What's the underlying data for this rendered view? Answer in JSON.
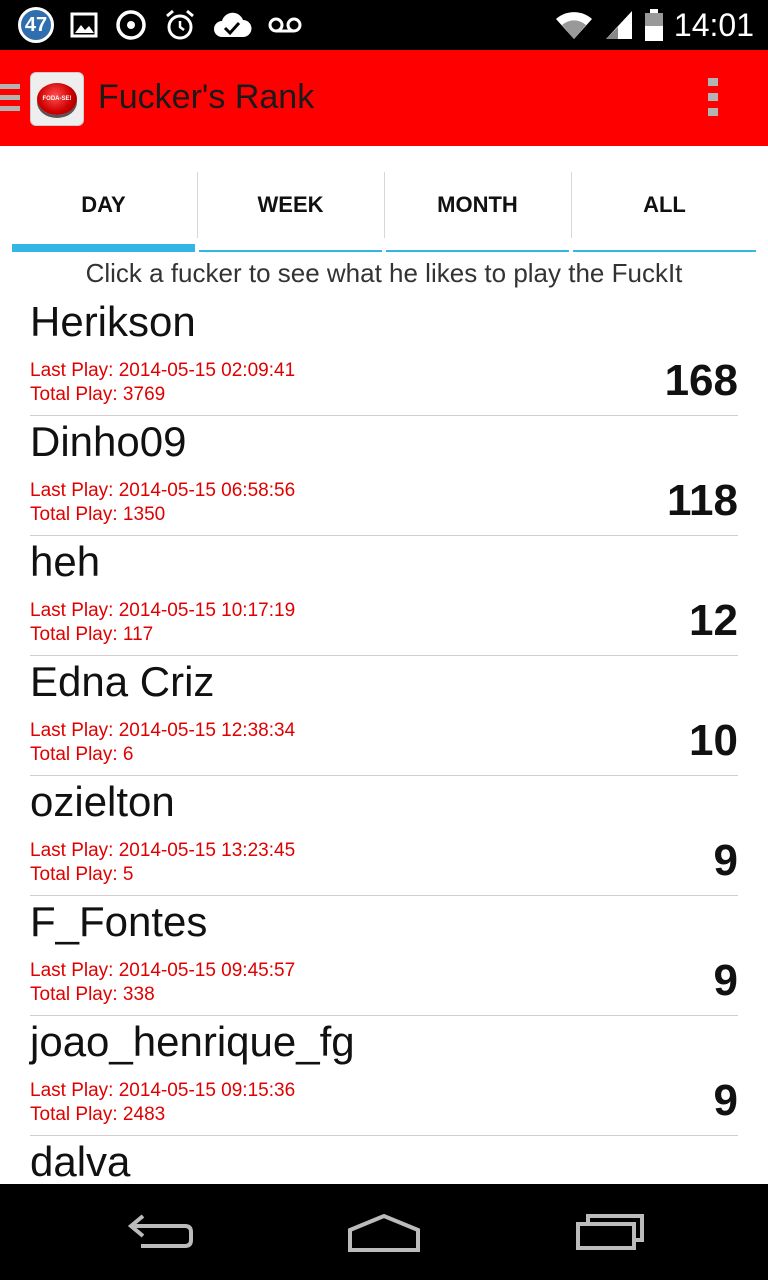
{
  "status_bar": {
    "notification_count": "47",
    "time": "14:01",
    "left_icons": [
      "notification-count-icon",
      "image-icon",
      "sync-icon",
      "alarm-icon",
      "cloud-check-icon",
      "voicemail-icon"
    ],
    "right_icons": [
      "wifi-icon",
      "signal-icon",
      "battery-icon"
    ]
  },
  "action_bar": {
    "title": "Fucker's Rank",
    "logo_text": "FODA-SE!",
    "color": "#ff0000"
  },
  "tabs": [
    {
      "label": "DAY",
      "active": true
    },
    {
      "label": "WEEK",
      "active": false
    },
    {
      "label": "MONTH",
      "active": false
    },
    {
      "label": "ALL",
      "active": false
    }
  ],
  "hint": "Click a fucker to see what he likes to play the FuckIt",
  "rank": [
    {
      "name": "Herikson",
      "last_play": "Last Play: 2014-05-15 02:09:41",
      "total_play": "Total Play: 3769",
      "score": "168"
    },
    {
      "name": "Dinho09",
      "last_play": "Last Play: 2014-05-15 06:58:56",
      "total_play": "Total Play: 1350",
      "score": "118"
    },
    {
      "name": "heh",
      "last_play": "Last Play: 2014-05-15 10:17:19",
      "total_play": "Total Play: 117",
      "score": "12"
    },
    {
      "name": "Edna Criz",
      "last_play": "Last Play: 2014-05-15 12:38:34",
      "total_play": "Total Play: 6",
      "score": "10"
    },
    {
      "name": "ozielton",
      "last_play": "Last Play: 2014-05-15 13:23:45",
      "total_play": "Total Play: 5",
      "score": "9"
    },
    {
      "name": "F_Fontes",
      "last_play": "Last Play: 2014-05-15 09:45:57",
      "total_play": "Total Play: 338",
      "score": "9"
    },
    {
      "name": "joao_henrique_fg",
      "last_play": "Last Play: 2014-05-15 09:15:36",
      "total_play": "Total Play: 2483",
      "score": "9"
    },
    {
      "name": "dalva",
      "last_play": "",
      "total_play": "",
      "score": ""
    }
  ],
  "nav_bar": [
    "back-icon",
    "home-icon",
    "recents-icon"
  ],
  "colors": {
    "accent": "#33b5e5",
    "red_text": "#e00000"
  }
}
